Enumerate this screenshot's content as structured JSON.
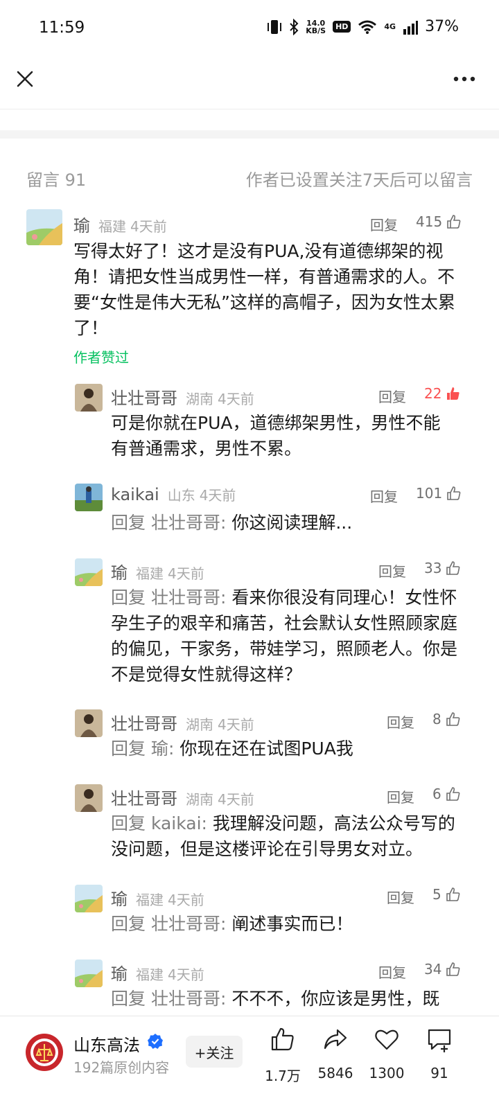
{
  "status_bar": {
    "time": "11:59",
    "net_speed_value": "14.0",
    "net_speed_unit": "KB/S",
    "hd": "HD",
    "network": "4G",
    "battery": "37%"
  },
  "comments_header": {
    "title": "留言 91",
    "notice": "作者已设置关注7天后可以留言"
  },
  "reply_label": "回复",
  "comments": [
    {
      "name": "瑜",
      "region": "福建",
      "time": "4天前",
      "likes": "415",
      "text": "写得太好了！这才是没有PUA,没有道德绑架的视角！请把女性当成男性一样，有普通需求的人。不要“女性是伟大无私”这样的高帽子，因为女性太累了！",
      "author_liked": "作者赞过"
    },
    {
      "name": "壮壮哥哥",
      "region": "湖南",
      "time": "4天前",
      "likes": "22",
      "text": "可是你就在PUA，道德绑架男性，男性不能有普通需求，男性不累。"
    },
    {
      "name": "kaikai",
      "region": "山东",
      "time": "4天前",
      "likes": "101",
      "reply_to": "回复 壮壮哥哥:",
      "text": " 你这阅读理解..."
    },
    {
      "name": "瑜",
      "region": "福建",
      "time": "4天前",
      "likes": "33",
      "reply_to": "回复 壮壮哥哥:",
      "text": " 看来你很没有同理心！女性怀孕生子的艰辛和痛苦，社会默认女性照顾家庭的偏见，干家务，带娃学习，照顾老人。你是不是觉得女性就得这样？"
    },
    {
      "name": "壮壮哥哥",
      "region": "湖南",
      "time": "4天前",
      "likes": "8",
      "reply_to": "回复 瑜:",
      "text": " 你现在还在试图PUA我"
    },
    {
      "name": "壮壮哥哥",
      "region": "湖南",
      "time": "4天前",
      "likes": "6",
      "reply_to": "回复 kaikai:",
      "text": " 我理解没问题，高法公众号写的没问题，但是这楼评论在引导男女对立。"
    },
    {
      "name": "瑜",
      "region": "福建",
      "time": "4天前",
      "likes": "5",
      "reply_to": "回复 壮壮哥哥:",
      "text": " 阐述事实而已！"
    },
    {
      "name": "瑜",
      "region": "福建",
      "time": "4天前",
      "likes": "34",
      "reply_to": "回复 壮壮哥哥:",
      "text": " 不不不，你应该是男性，既"
    }
  ],
  "bottom_bar": {
    "account_name": "山东高法",
    "account_sub": "192篇原创内容",
    "follow_label": "+关注",
    "like_count": "1.7万",
    "share_count": "5846",
    "favorite_count": "1300",
    "comment_count": "91"
  },
  "colors": {
    "liked_red": "#fa5151",
    "author_green": "#07c160",
    "verified_blue": "#1e6fff"
  }
}
